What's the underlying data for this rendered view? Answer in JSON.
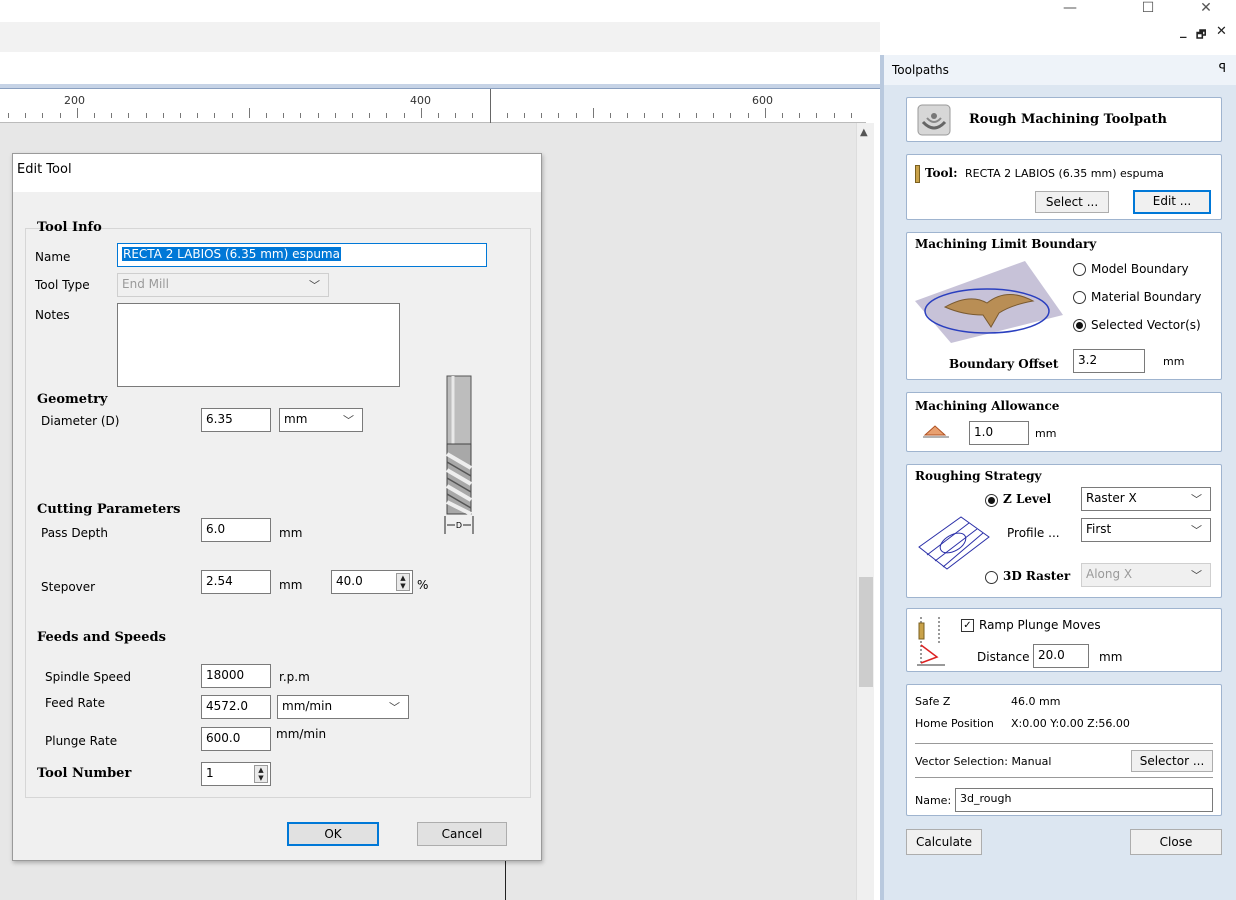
{
  "window": {
    "minimize": "—",
    "maximize": "☐",
    "close": "✕",
    "mdi_min": "_",
    "mdi_restore": "🗗",
    "mdi_close": "✕"
  },
  "ruler": {
    "labels": [
      "200",
      "400",
      "600"
    ]
  },
  "dialog": {
    "title": "Edit Tool",
    "tool_info_heading": "Tool Info",
    "name_label": "Name",
    "name_value": "RECTA 2 LABIOS (6.35 mm) espuma",
    "tool_type_label": "Tool Type",
    "tool_type_value": "End Mill",
    "notes_label": "Notes",
    "notes_value": "",
    "geometry_heading": "Geometry",
    "diameter_label": "Diameter (D)",
    "diameter_value": "6.35",
    "diameter_unit": "mm",
    "cutting_heading": "Cutting Parameters",
    "pass_depth_label": "Pass Depth",
    "pass_depth_value": "6.0",
    "pass_depth_unit": "mm",
    "stepover_label": "Stepover",
    "stepover_value": "2.54",
    "stepover_unit": "mm",
    "stepover_pct": "40.0",
    "pct_sign": "%",
    "feeds_heading": "Feeds and Speeds",
    "spindle_label": "Spindle Speed",
    "spindle_value": "18000",
    "spindle_unit": "r.p.m",
    "feed_label": "Feed Rate",
    "feed_value": "4572.0",
    "feed_unit": "mm/min",
    "plunge_label": "Plunge Rate",
    "plunge_value": "600.0",
    "plunge_unit": "mm/min",
    "tool_number_label": "Tool Number",
    "tool_number_value": "1",
    "diagram_label": "D",
    "ok": "OK",
    "cancel": "Cancel"
  },
  "panel": {
    "title": "Toolpaths",
    "pin": "ꟼ",
    "header": "Rough Machining Toolpath",
    "tool_label": "Tool:",
    "tool_value": "RECTA 2 LABIOS (6.35 mm) espuma",
    "select_btn": "Select ...",
    "edit_btn": "Edit ...",
    "boundary_heading": "Machining Limit Boundary",
    "model_boundary": "Model Boundary",
    "material_boundary": "Material Boundary",
    "selected_vectors": "Selected Vector(s)",
    "boundary_offset_label": "Boundary Offset",
    "boundary_offset_value": "3.2",
    "boundary_offset_unit": "mm",
    "allowance_heading": "Machining Allowance",
    "allowance_value": "1.0",
    "allowance_unit": "mm",
    "strategy_heading": "Roughing Strategy",
    "z_level": "Z Level",
    "z_level_mode": "Raster X",
    "profile_label": "Profile ...",
    "profile_value": "First",
    "raster_3d": "3D Raster",
    "raster_3d_mode": "Along X",
    "ramp_label": "Ramp Plunge Moves",
    "distance_label": "Distance",
    "distance_value": "20.0",
    "distance_unit": "mm",
    "safe_z_label": "Safe Z",
    "safe_z_value": "46.0 mm",
    "home_label": "Home Position",
    "home_value": "X:0.00 Y:0.00 Z:56.00",
    "vector_sel_label": "Vector Selection: Manual",
    "selector_btn": "Selector ...",
    "name_label": "Name:",
    "name_value": "3d_rough",
    "calculate_btn": "Calculate",
    "close_btn": "Close"
  }
}
